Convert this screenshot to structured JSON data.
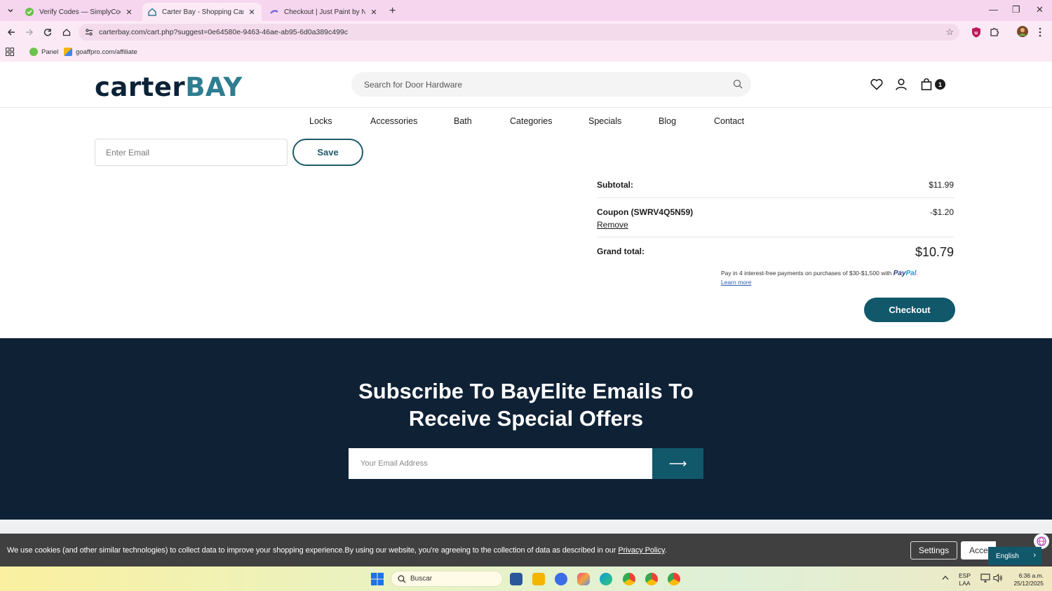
{
  "browser": {
    "tabs": [
      {
        "title": "Verify Codes — SimplyCodes",
        "active": false
      },
      {
        "title": "Carter Bay - Shopping Cart",
        "active": true
      },
      {
        "title": "Checkout | Just Paint by Numbe",
        "active": false
      }
    ],
    "url": "carterbay.com/cart.php?suggest=0e64580e-9463-46ae-ab95-6d0a389c499c",
    "bookmarks": [
      "Panel",
      "goaffpro.com/affiliate"
    ]
  },
  "site": {
    "logo_a": "carter",
    "logo_b": "BAY",
    "search_placeholder": "Search for Door Hardware",
    "cart_count": "1",
    "nav": [
      "Locks",
      "Accessories",
      "Bath",
      "Categories",
      "Specials",
      "Blog",
      "Contact"
    ]
  },
  "cart": {
    "email_placeholder": "Enter Email",
    "save_label": "Save",
    "subtotal_label": "Subtotal:",
    "subtotal_value": "$11.99",
    "coupon_label": "Coupon (SWRV4Q5N59)",
    "coupon_value": "-$1.20",
    "remove_label": "Remove",
    "grand_label": "Grand total:",
    "grand_value": "$10.79",
    "paypal_text": "Pay in 4 interest-free payments on purchases of $30-$1,500 with",
    "paypal_brand_a": "Pay",
    "paypal_brand_b": "Pal",
    "learn_more": "Learn more",
    "checkout_label": "Checkout"
  },
  "newsletter": {
    "title": "Subscribe To BayElite Emails To Receive Special Offers",
    "placeholder": "Your Email Address",
    "submit_icon": "⟶"
  },
  "cookie": {
    "text": "We use cookies (and other similar technologies) to collect data to improve your shopping experience.By using our website, you're agreeing to the collection of data as described in our",
    "privacy_link": "Privacy Policy",
    "settings_label": "Settings",
    "accept_label": "Accept",
    "language": "English"
  },
  "taskbar": {
    "search_placeholder": "Buscar",
    "lang_top": "ESP",
    "lang_bottom": "LAA",
    "time": "6:36 a.m.",
    "date": "25/12/2025"
  },
  "colors": {
    "brand_dark": "#0f2135",
    "brand_teal": "#11586b"
  }
}
